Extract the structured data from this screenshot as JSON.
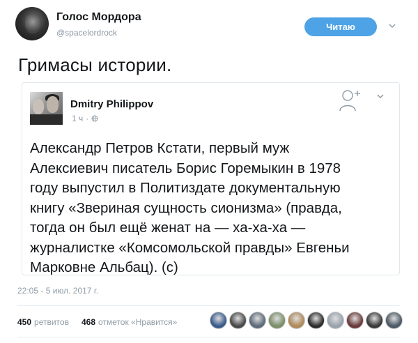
{
  "author": {
    "name": "Голос Мордора",
    "handle": "@spacelordrock",
    "avatar_icon": "avatar-dark-portrait"
  },
  "follow_button": {
    "label": "Читаю",
    "color": "#4da3e6"
  },
  "tweet": {
    "text": "Гримасы истории.",
    "timestamp": "22:05 - 5 июл. 2017 г."
  },
  "quote": {
    "author_name": "Dmitry Philippov",
    "time": "1 ч",
    "body_lines": [
      "Александр Петров Кстати, первый муж",
      "Алексиевич писатель Борис Горемыкин в 1978",
      "году выпустил в Политиздате документальную",
      "книгу «Звериная сущность сионизма» (правда,",
      "тогда он был ещё женат на — ха-ха-ха —",
      "журналистке «Комсомольской правды» Евгеньи",
      "Марковне Альбац). (c)"
    ]
  },
  "stats": {
    "retweets_count": "450",
    "retweets_label": "ретвитов",
    "likes_count": "468",
    "likes_label": "отметок «Нравится»"
  },
  "likers": [
    {
      "name": "liker-avatar-1",
      "color": "#3a5c8c"
    },
    {
      "name": "liker-avatar-2",
      "color": "#4a4a4a"
    },
    {
      "name": "liker-avatar-3",
      "color": "#5e6b7a"
    },
    {
      "name": "liker-avatar-4",
      "color": "#7b8f6a"
    },
    {
      "name": "liker-avatar-5",
      "color": "#b08a5a"
    },
    {
      "name": "liker-avatar-6",
      "color": "#2d2d2d"
    },
    {
      "name": "liker-avatar-7",
      "color": "#9aa3ad"
    },
    {
      "name": "liker-avatar-8",
      "color": "#6b3b3b"
    },
    {
      "name": "liker-avatar-9",
      "color": "#3b3b3b"
    },
    {
      "name": "liker-avatar-10",
      "color": "#4d5a66"
    }
  ]
}
